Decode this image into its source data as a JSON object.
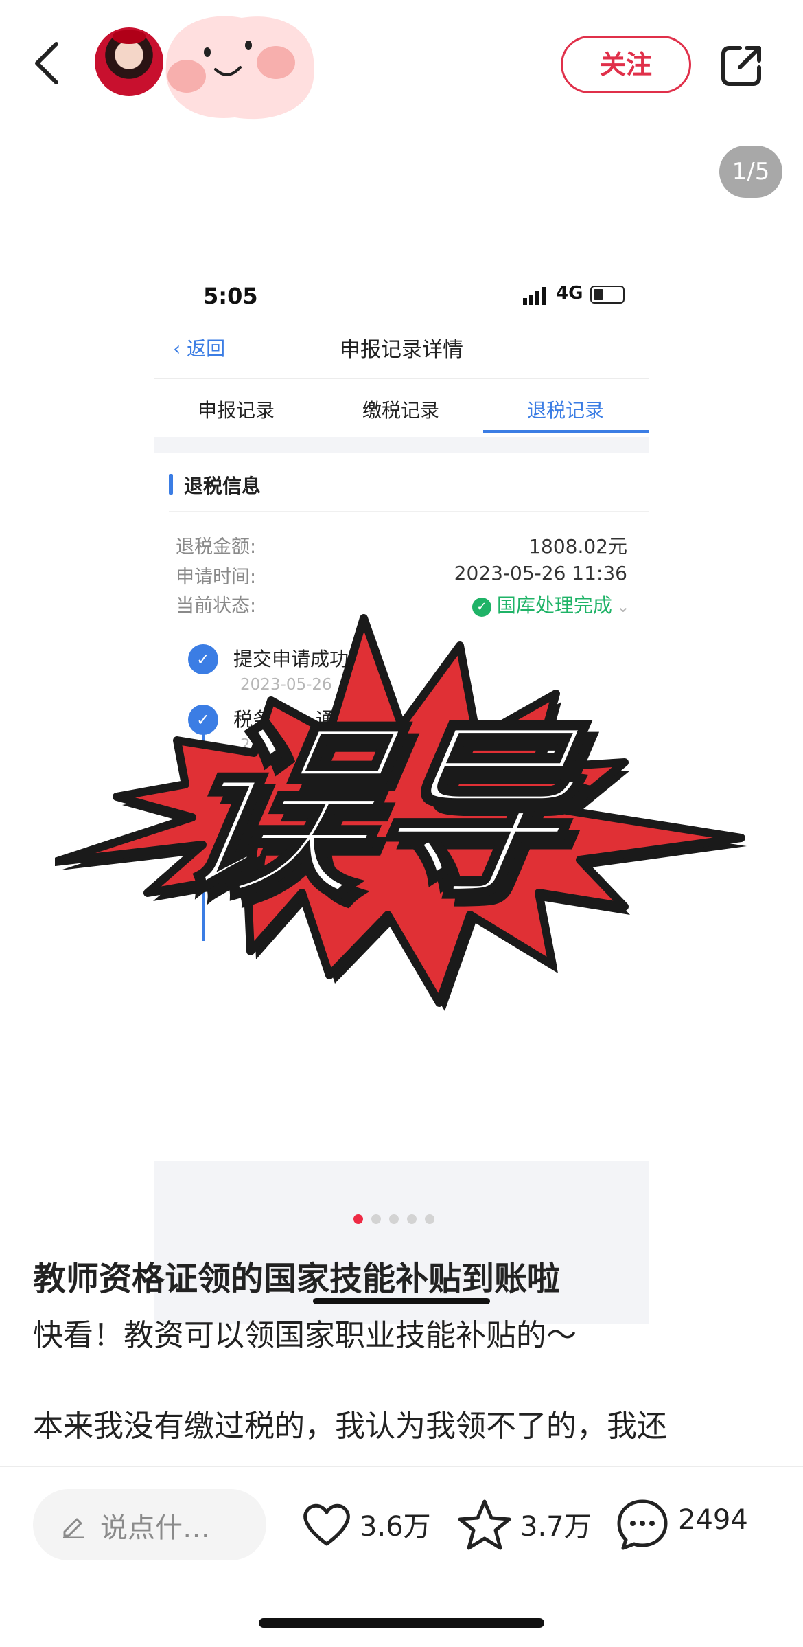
{
  "header": {
    "follow_label": "关注",
    "page_counter": "1/5"
  },
  "screenshot": {
    "time": "5:05",
    "network": "4G",
    "back_label": "返回",
    "title": "申报记录详情",
    "tabs": [
      "申报记录",
      "缴税记录",
      "退税记录"
    ],
    "active_tab": "退税记录",
    "section_title": "退税信息",
    "rows": [
      {
        "label": "退税金额:",
        "value": "1808.02元"
      },
      {
        "label": "申请时间:",
        "value": "2023-05-26 11:36"
      },
      {
        "label": "当前状态:",
        "value": "国库处理完成"
      }
    ],
    "timeline": [
      {
        "step": "提交申请成功",
        "date": "2023-05-26"
      },
      {
        "step": "税务",
        "suffix": "通过",
        "date": "2"
      }
    ],
    "status_color": "#1fb367",
    "accent_color": "#3b7de4"
  },
  "sticker": {
    "text": "误导",
    "color": "#e03035"
  },
  "carousel": {
    "dot_count": 5,
    "active_dot": 0
  },
  "post": {
    "title": "教师资格证领的国家技能补贴到账啦",
    "lines": [
      "快看！教资可以领国家职业技能补贴的～",
      "本来我没有缴过税的，我认为我领不了的，我还"
    ]
  },
  "actions": {
    "comment_placeholder": "说点什…",
    "likes": "3.6万",
    "collects": "3.7万",
    "comments": "2494",
    "accent_color": "#ee2a44"
  }
}
